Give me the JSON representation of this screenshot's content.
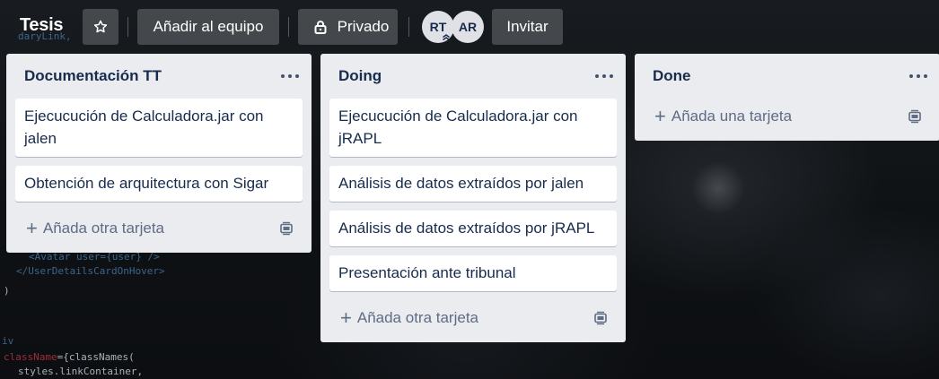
{
  "header": {
    "board_title": "Tesis",
    "team_button": "Añadir al equipo",
    "privacy_button": "Privado",
    "invite_button": "Invitar",
    "members": [
      {
        "initials": "RT"
      },
      {
        "initials": "AR"
      }
    ]
  },
  "lists": [
    {
      "title": "Documentación TT",
      "cards": [
        "Ejecucución de Calculadora.jar con jalen",
        "Obtención de arquitectura con Sigar"
      ],
      "add_label": "Añada otra tarjeta"
    },
    {
      "title": "Doing",
      "cards": [
        "Ejecucución de Calculadora.jar con jRAPL",
        "Análisis de datos extraídos por jalen",
        "Análisis de datos extraídos por jRAPL",
        "Presentación ante tribunal"
      ],
      "add_label": "Añada otra tarjeta"
    },
    {
      "title": "Done",
      "cards": [],
      "add_label": "Añada una tarjeta"
    }
  ],
  "background_code": {
    "line1": "daryLink,",
    "line2": "<Avatar user={user} />",
    "line3": "</UserDetailsCardOnHover>",
    "line4": ")",
    "line5": "iv",
    "line6_attr": "className",
    "line6_rest": "={classNames(",
    "line7": "styles.linkContainer,"
  },
  "colors": {
    "list_bg": "#ebecf0",
    "card_bg": "#ffffff",
    "text": "#172b4d",
    "muted": "#5e6c84"
  }
}
